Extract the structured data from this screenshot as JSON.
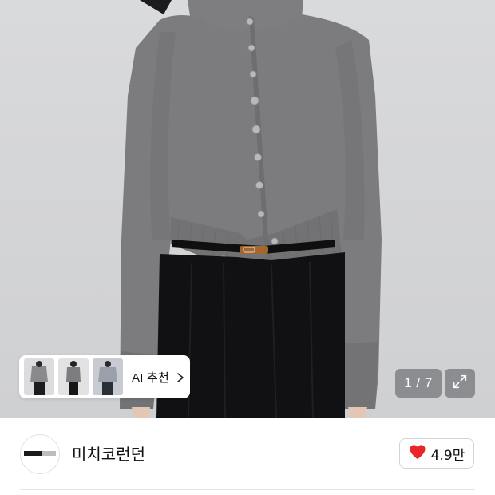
{
  "product_image": {
    "ai_recommend": {
      "label": "AI 추천",
      "thumbnail_count": 3,
      "chevron_icon": "chevron-right-icon"
    },
    "pager": {
      "text": "1 / 7"
    },
    "expand_icon": "expand-icon"
  },
  "store": {
    "name": "미치코런던",
    "logo_icon": "store-logo-icon"
  },
  "like": {
    "icon": "heart-icon",
    "count": "4.9만",
    "color": "#e8262a"
  }
}
